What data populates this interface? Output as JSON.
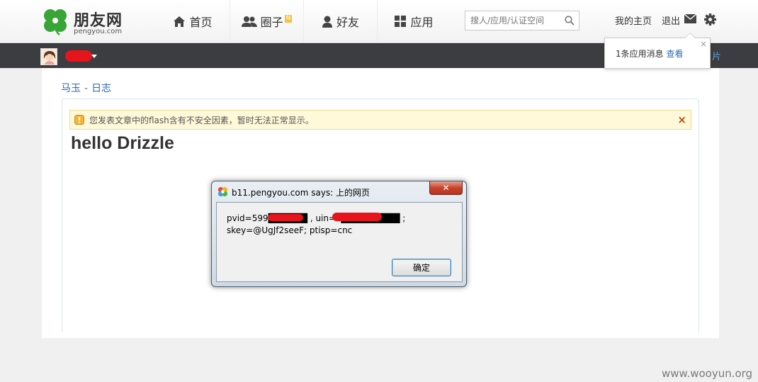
{
  "brand": {
    "name": "朋友网",
    "domain": "pengyou.com"
  },
  "nav": {
    "items": [
      {
        "label": "首页",
        "icon": "home-icon"
      },
      {
        "label": "圈子",
        "icon": "people-icon",
        "badge": "N"
      },
      {
        "label": "好友",
        "icon": "person-icon"
      },
      {
        "label": "应用",
        "icon": "grid-icon"
      }
    ]
  },
  "search": {
    "placeholder": "搜人/应用/认证空间"
  },
  "top_links": {
    "my_home": "我的主页",
    "logout": "退出"
  },
  "darkbar": {
    "right_text": "片"
  },
  "notification": {
    "text": "1条应用消息",
    "link": "查看",
    "close": "×"
  },
  "breadcrumb": {
    "author": "马玉",
    "separator": "-",
    "section": "日志"
  },
  "warning": {
    "text": "您发表文章中的flash含有不安全因素，暂时无法正常显示。",
    "dismiss": "×"
  },
  "article": {
    "title": "hello Drizzle"
  },
  "dialog": {
    "title": "b11.pengyou.com says: 上的网页",
    "line1": "pvid=599██████ , uin=o█████████ ;",
    "line2": "skey=@UgJf2seeF; ptisp=cnc",
    "ok_label": "确定"
  },
  "watermark": "www.wooyun.org",
  "colors": {
    "brand_green": "#3aa537",
    "link_blue": "#2a6ab0",
    "darkbar": "#3b3d40",
    "redaction": "#e8141b",
    "warning_bg": "#fff8d9"
  }
}
